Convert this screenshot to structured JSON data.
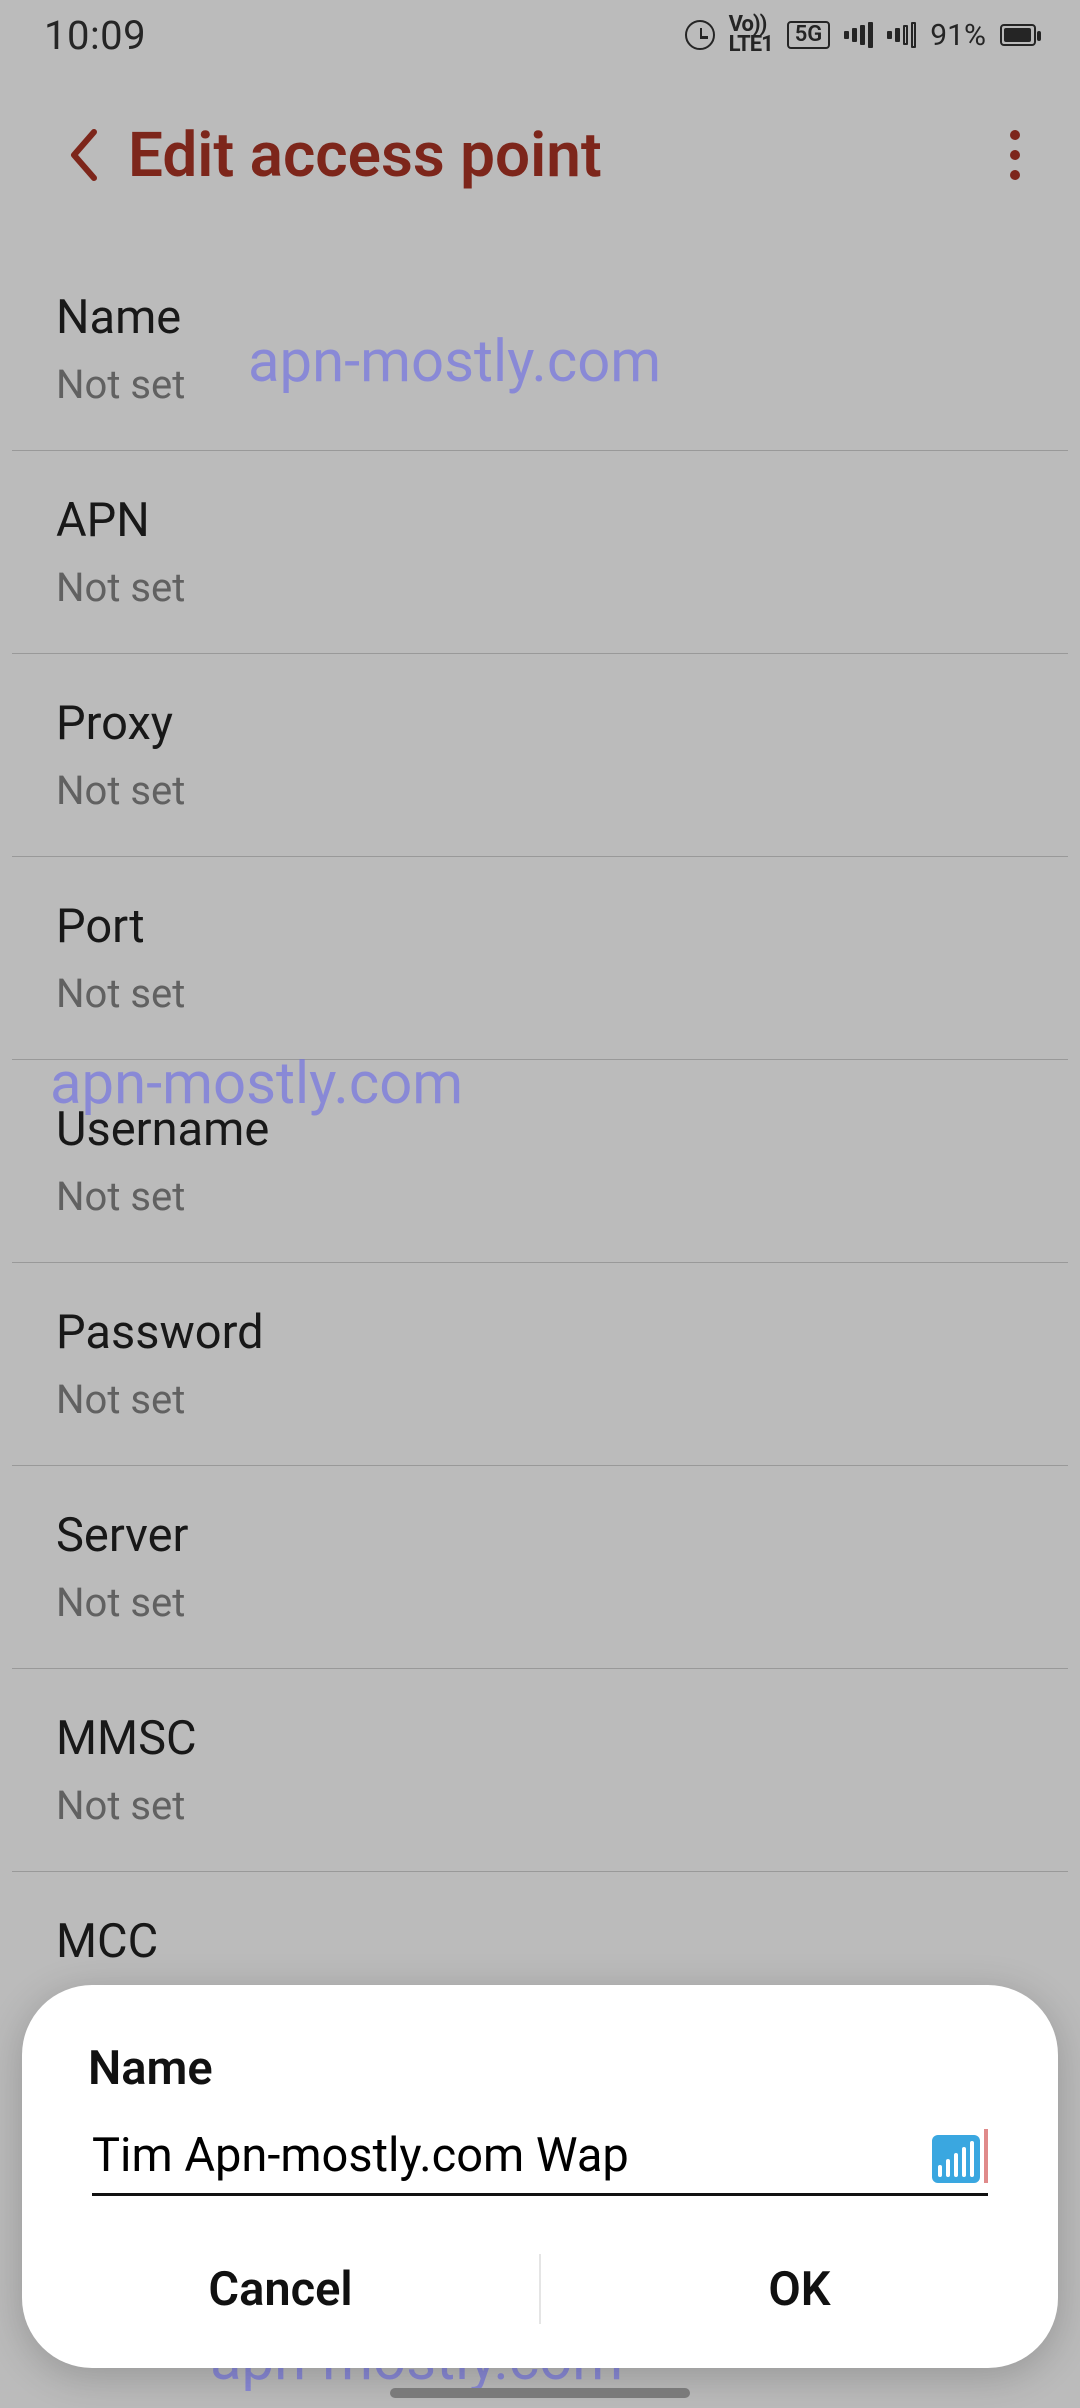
{
  "status": {
    "time": "10:09",
    "battery_pct": "91%",
    "icons": {
      "alarm": "alarm-icon",
      "volte": "Vo))\nLTE1",
      "fiveg": "5G"
    }
  },
  "header": {
    "title": "Edit access point"
  },
  "not_set": "Not set",
  "fields": [
    {
      "label": "Name"
    },
    {
      "label": "APN"
    },
    {
      "label": "Proxy"
    },
    {
      "label": "Port"
    },
    {
      "label": "Username"
    },
    {
      "label": "Password"
    },
    {
      "label": "Server"
    },
    {
      "label": "MMSC"
    }
  ],
  "peek_field": {
    "label": "MCC"
  },
  "dialog": {
    "title": "Name",
    "input_value": "Tim Apn-mostly.com Wap",
    "cancel": "Cancel",
    "ok": "OK"
  },
  "watermark": "apn-mostly.com"
}
